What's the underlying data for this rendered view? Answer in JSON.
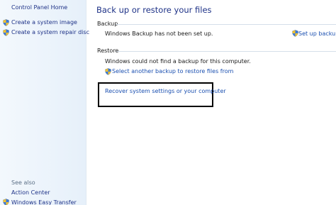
{
  "sidebar": {
    "home": "Control Panel Home",
    "tasks": [
      {
        "label": "Create a system image",
        "icon": "shield-icon"
      },
      {
        "label": "Create a system repair disc",
        "icon": "shield-icon"
      }
    ],
    "see_also": {
      "heading": "See also",
      "items": [
        {
          "label": "Action Center"
        },
        {
          "label": "Windows Easy Transfer",
          "icon": "shield-icon"
        }
      ]
    }
  },
  "main": {
    "title": "Back up or restore your files",
    "backup": {
      "heading": "Backup",
      "status": "Windows Backup has not been set up.",
      "setup_link": "Set up backup"
    },
    "restore": {
      "heading": "Restore",
      "status": "Windows could not find a backup for this computer.",
      "select_link": "Select another backup to restore files from",
      "recover_link": "Recover system settings or your computer"
    }
  },
  "colors": {
    "link": "#1a4fb0",
    "title": "#1e3287",
    "sidebar_bg": "#e6f0fa",
    "highlight_border": "#000000"
  }
}
